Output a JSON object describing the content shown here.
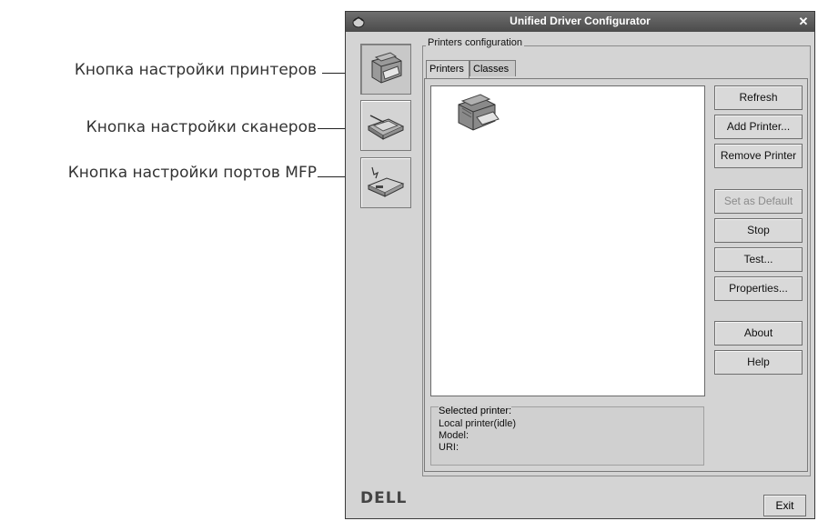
{
  "callouts": [
    {
      "label": "Кнопка настройки принтеров"
    },
    {
      "label": "Кнопка настройки сканеров"
    },
    {
      "label": "Кнопка настройки портов MFP"
    }
  ],
  "window": {
    "title": "Unified Driver Configurator",
    "close_glyph": "✕"
  },
  "sidebar": {
    "items": [
      {
        "name": "printer-config",
        "icon": "printer-icon",
        "active": true
      },
      {
        "name": "scanner-config",
        "icon": "scanner-icon",
        "active": false
      },
      {
        "name": "port-config",
        "icon": "port-icon",
        "active": false
      }
    ]
  },
  "config": {
    "frame_label": "Printers configuration",
    "tabs": [
      {
        "label": "Printers",
        "active": true
      },
      {
        "label": "Classes",
        "active": false
      }
    ]
  },
  "printer_list": {
    "items": [
      {
        "icon": "printer-icon"
      }
    ]
  },
  "selected_printer": {
    "legend": "Selected printer:",
    "status": "Local printer(idle)",
    "model_label": "Model:",
    "uri_label": "URI:"
  },
  "buttons": {
    "refresh": "Refresh",
    "add_printer": "Add Printer...",
    "remove_printer": "Remove Printer",
    "set_default": "Set as Default",
    "stop": "Stop",
    "test": "Test...",
    "properties": "Properties...",
    "about": "About",
    "help": "Help"
  },
  "footer": {
    "brand": "DELL",
    "exit": "Exit"
  }
}
